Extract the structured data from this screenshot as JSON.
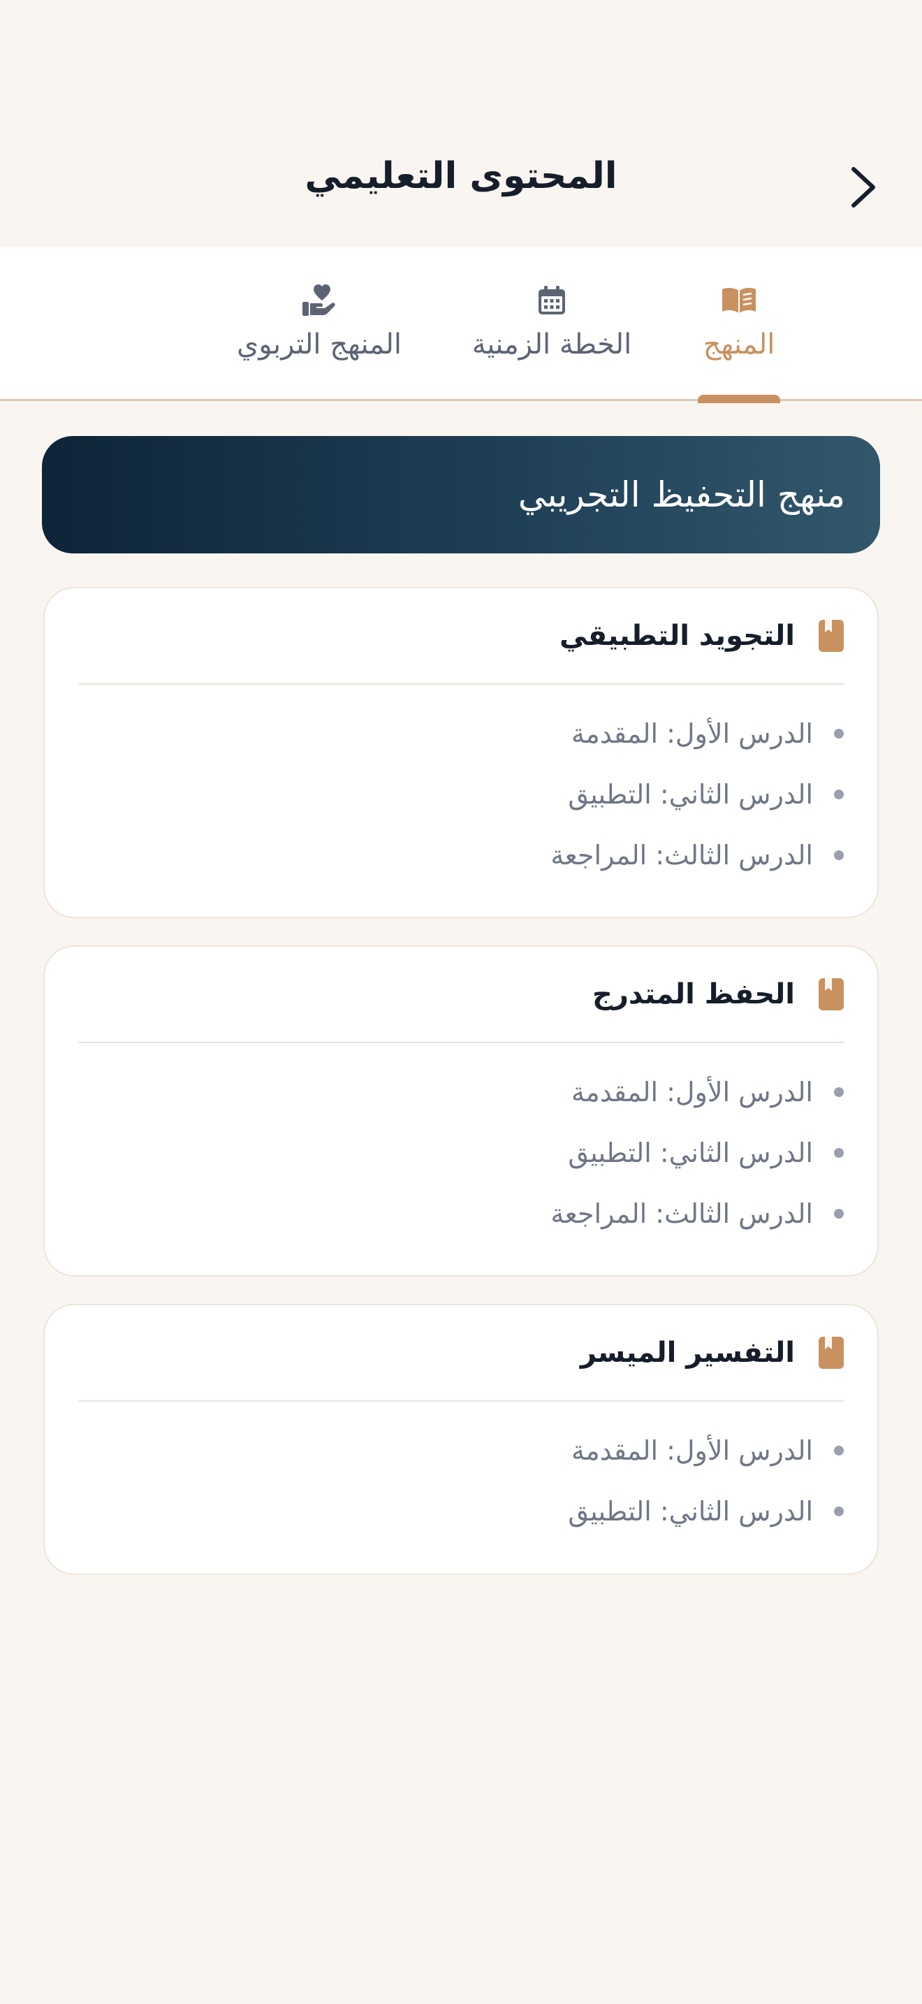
{
  "header": {
    "title": "المحتوى التعليمي",
    "back_icon": "chevron-right-icon"
  },
  "tabs": [
    {
      "label": "المنهج",
      "icon": "book-open-icon",
      "active": true
    },
    {
      "label": "الخطة الزمنية",
      "icon": "calendar-icon",
      "active": false
    },
    {
      "label": "المنهج التربوي",
      "icon": "hand-heart-icon",
      "active": false
    }
  ],
  "banner": {
    "title": "منهج التحفيظ التجريبي"
  },
  "cards": [
    {
      "title": "التجويد التطبيقي",
      "icon": "book-icon",
      "lessons": [
        "الدرس الأول: المقدمة",
        "الدرس الثاني: التطبيق",
        "الدرس الثالث: المراجعة"
      ]
    },
    {
      "title": "الحفظ المتدرج",
      "icon": "book-icon",
      "lessons": [
        "الدرس الأول: المقدمة",
        "الدرس الثاني: التطبيق",
        "الدرس الثالث: المراجعة"
      ]
    },
    {
      "title": "التفسير الميسر",
      "icon": "book-icon",
      "lessons": [
        "الدرس الأول: المقدمة",
        "الدرس الثاني: التطبيق"
      ]
    }
  ],
  "colors": {
    "accent": "#c8915f",
    "background": "#f9f6f2",
    "banner_start": "#0e2438",
    "banner_end": "#32576b",
    "text_primary": "#161d2b",
    "text_secondary": "#6f7686"
  }
}
